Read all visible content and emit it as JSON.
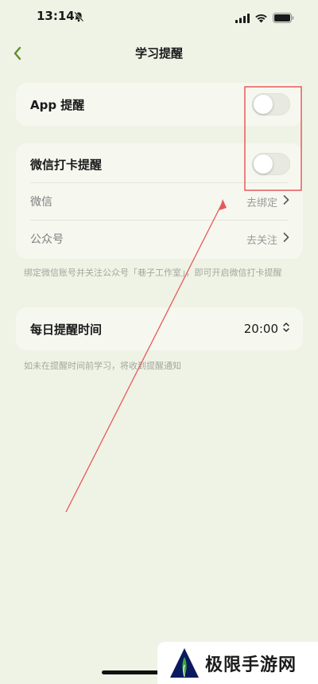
{
  "status_bar": {
    "time": "13:14"
  },
  "nav": {
    "title": "学习提醒"
  },
  "app_reminder": {
    "label": "App 提醒",
    "enabled": false
  },
  "wechat_card": {
    "checkin_label": "微信打卡提醒",
    "checkin_enabled": false,
    "wechat_label": "微信",
    "wechat_action": "去绑定",
    "official_label": "公众号",
    "official_action": "去关注"
  },
  "wechat_hint": "绑定微信账号并关注公众号「巷子工作室」，即可开启微信打卡提醒",
  "daily": {
    "label": "每日提醒时间",
    "time": "20:00"
  },
  "daily_hint": "如未在提醒时间前学习，将收到提醒通知",
  "watermark": {
    "text": "极限手游网"
  },
  "colors": {
    "background": "#eff3e6",
    "card": "#f6f8f0",
    "accent_green": "#5f8d2b",
    "annotation_red": "#e8585b"
  }
}
